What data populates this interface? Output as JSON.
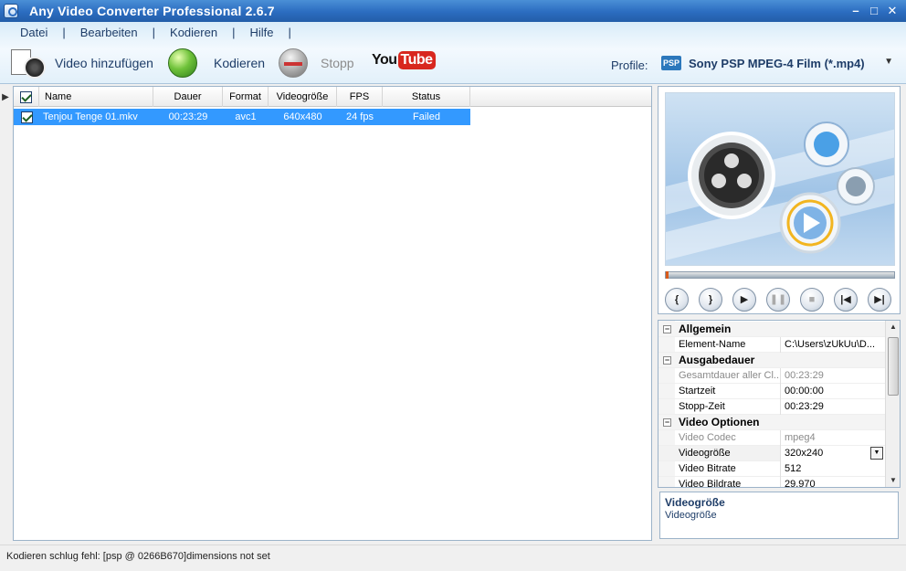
{
  "window": {
    "title": "Any Video Converter Professional 2.6.7"
  },
  "menu": {
    "items": [
      "Datei",
      "Bearbeiten",
      "Kodieren",
      "Hilfe"
    ]
  },
  "toolbar": {
    "add_video": "Video hinzufügen",
    "encode": "Kodieren",
    "stop": "Stopp",
    "youtube_you": "You",
    "youtube_tube": "Tube",
    "profile_label": "Profile:",
    "profile_badge": "PSP",
    "profile_value": "Sony PSP MPEG-4 Film (*.mp4)"
  },
  "filelist": {
    "columns": [
      "Name",
      "Dauer",
      "Format",
      "Videogröße",
      "FPS",
      "Status"
    ],
    "rows": [
      {
        "name": "Tenjou Tenge 01.mkv",
        "duration": "00:23:29",
        "format": "avc1",
        "size": "640x480",
        "fps": "24 fps",
        "status": "Failed",
        "checked": true
      }
    ]
  },
  "player": {
    "buttons": [
      "{",
      "}",
      "play",
      "pause",
      "stop",
      "prev",
      "next"
    ]
  },
  "properties": {
    "categories": {
      "general": "Allgemein",
      "output_duration": "Ausgabedauer",
      "video_options": "Video Optionen"
    },
    "rows": {
      "element_name": {
        "name": "Element-Name",
        "value": "C:\\Users\\zUkUu\\D..."
      },
      "total_duration": {
        "name": "Gesamtdauer aller Cl...",
        "value": "00:23:29"
      },
      "start_time": {
        "name": "Startzeit",
        "value": "00:00:00"
      },
      "stop_time": {
        "name": "Stopp-Zeit",
        "value": "00:23:29"
      },
      "video_codec": {
        "name": "Video Codec",
        "value": "mpeg4"
      },
      "video_size": {
        "name": "Videogröße",
        "value": "320x240"
      },
      "video_bitrate": {
        "name": "Video Bitrate",
        "value": "512"
      },
      "video_framerate": {
        "name": "Video Bildrate",
        "value": "29.970"
      }
    }
  },
  "description": {
    "title": "Videogröße",
    "text": "Videogröße"
  },
  "status": {
    "text": "Kodieren schlug fehl: [psp @ 0266B670]dimensions not set"
  },
  "colors": {
    "selection": "#3399ff",
    "titlebar": "#2b6cc0",
    "status_failed": "#ffffff"
  }
}
